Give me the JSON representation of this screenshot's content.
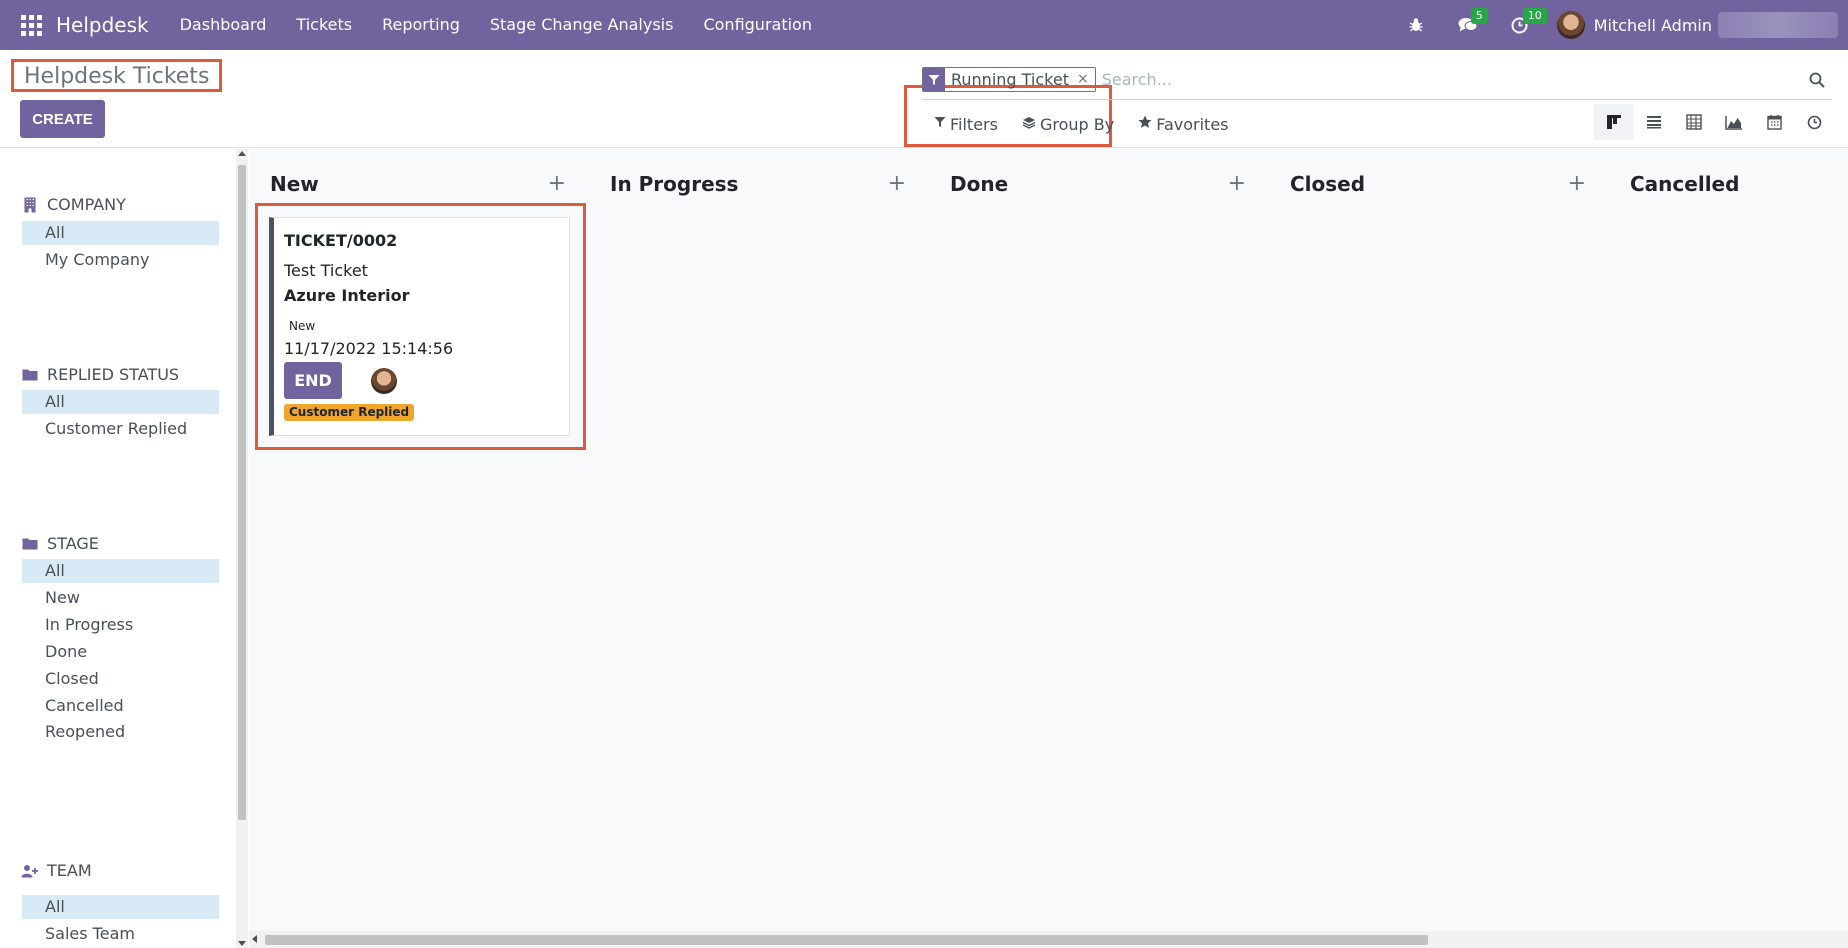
{
  "navbar": {
    "brand": "Helpdesk",
    "menu": [
      {
        "label": "Dashboard"
      },
      {
        "label": "Tickets"
      },
      {
        "label": "Reporting"
      },
      {
        "label": "Stage Change Analysis"
      },
      {
        "label": "Configuration"
      }
    ],
    "messages_badge": "5",
    "activities_badge": "10",
    "user_name": "Mitchell Admin",
    "icons": [
      "apps-grid-icon",
      "bug-icon",
      "chat-icon",
      "clock-icon"
    ]
  },
  "control_panel": {
    "title": "Helpdesk Tickets",
    "create_label": "CREATE",
    "search": {
      "facet_label": "Running Ticket",
      "facet_remove": "×",
      "placeholder": "Search..."
    },
    "filters_label": "Filters",
    "group_by_label": "Group By",
    "favorites_label": "Favorites",
    "views": [
      "kanban",
      "list",
      "pivot",
      "graph",
      "calendar",
      "activity"
    ],
    "active_view": "kanban"
  },
  "sidepanel": {
    "sections": [
      {
        "title": "COMPANY",
        "items": [
          "All",
          "My Company"
        ]
      },
      {
        "title": "REPLIED STATUS",
        "items": [
          "All",
          "Customer Replied"
        ]
      },
      {
        "title": "STAGE",
        "items": [
          "All",
          "New",
          "In Progress",
          "Done",
          "Closed",
          "Cancelled",
          "Reopened"
        ]
      },
      {
        "title": "TEAM",
        "items": [
          "All",
          "Sales Team"
        ]
      }
    ]
  },
  "kanban": {
    "columns": [
      {
        "title": "New",
        "add": "+"
      },
      {
        "title": "In Progress",
        "add": "+"
      },
      {
        "title": "Done",
        "add": "+"
      },
      {
        "title": "Closed",
        "add": "+"
      },
      {
        "title": "Cancelled",
        "add": "+"
      }
    ],
    "card": {
      "reference": "TICKET/0002",
      "name": "Test Ticket",
      "partner": "Azure Interior",
      "stage": "New",
      "date": "11/17/2022 15:14:56",
      "end_label": "END",
      "tag": "Customer Replied",
      "tag_color": "#f0a52b"
    }
  },
  "colors": {
    "brand": "#71639e",
    "highlight": "#dd5a3d",
    "active_filter_bg": "#d8eaf6"
  }
}
